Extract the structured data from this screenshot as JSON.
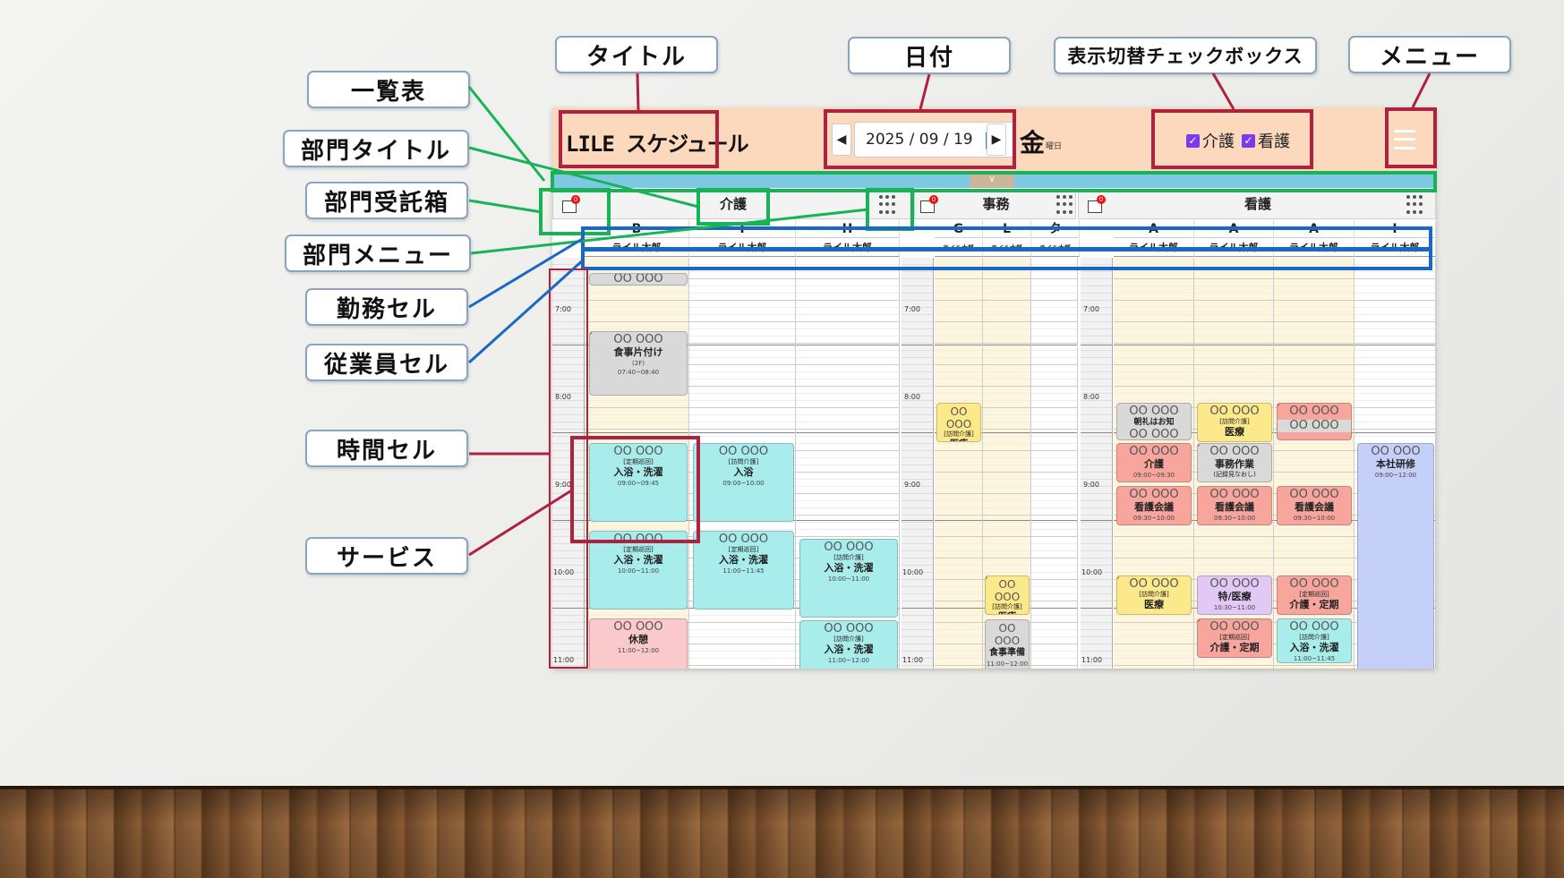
{
  "callouts": {
    "ichiranhyo": "一覧表",
    "bumon_title": "部門タイトル",
    "bumon_inbox": "部門受託箱",
    "bumon_menu": "部門メニュー",
    "kinmu_cell": "勤務セル",
    "jugyoin_cell": "従業員セル",
    "jikan_cell": "時間セル",
    "service": "サービス",
    "title": "タイトル",
    "date": "日付",
    "toggle": "表示切替チェックボックス",
    "menu": "メニュー"
  },
  "header": {
    "title": "LILE スケジュール",
    "date": "2025 / 09 / 19",
    "weekday": "金",
    "weekday_suffix": "曜日",
    "prev_icon": "caret-left-icon",
    "next_icon": "caret-right-icon",
    "toggles": [
      {
        "label": "介護",
        "checked": true
      },
      {
        "label": "看護",
        "checked": true
      }
    ],
    "collapse_glyph": "∨"
  },
  "departments": [
    {
      "title": "介護",
      "inbox_count": "0",
      "shifts": [
        "B",
        "I",
        "H"
      ],
      "employees": [
        "ライル太郎",
        "ライル太郎",
        "ライル太郎"
      ]
    },
    {
      "title": "事務",
      "inbox_count": "0",
      "shifts": [
        "G",
        "L",
        "タ"
      ],
      "employees": [
        "ライル太郎",
        "ライル太郎",
        "ライル太郎"
      ]
    },
    {
      "title": "看護",
      "inbox_count": "0",
      "shifts": [
        "A",
        "A",
        "A",
        "I"
      ],
      "employees": [
        "ライル太郎",
        "ライル太郎",
        "ライル太郎",
        "ライル太郎"
      ]
    }
  ],
  "times": [
    "7:00",
    "8:00",
    "9:00",
    "10:00",
    "11:00"
  ],
  "services": {
    "c0a": {
      "top": "OO OOO"
    },
    "c0b": {
      "top": "OO OOO",
      "tag": "",
      "name": "食事片付け",
      "sub": "(2F)",
      "time": "07:40~08:40"
    },
    "c0c": {
      "top": "OO OOO",
      "tag": "[定期巡回]",
      "name": "入浴・洗濯",
      "time": "09:00~09:45"
    },
    "c0d": {
      "top": "OO OOO",
      "tag": "[定期巡回]",
      "name": "入浴・洗濯",
      "time": "10:00~11:00"
    },
    "c0e": {
      "top": "OO OOO",
      "name": "休憩",
      "time": "11:00~12:00"
    },
    "c1a": {
      "top": "OO OOO",
      "tag": "[訪問介護]",
      "name": "入浴",
      "time": "09:00~10:00"
    },
    "c1b": {
      "top": "OO OOO",
      "tag": "[定期巡回]",
      "name": "入浴・洗濯",
      "time": "11:00~11:45"
    },
    "c2a": {
      "top": "OO OOO",
      "tag": "[訪問介護]",
      "name": "入浴・洗濯",
      "time": "10:00~11:00"
    },
    "c2b": {
      "top": "OO OOO",
      "tag": "[訪問介護]",
      "name": "入浴・洗濯",
      "time": "11:00~12:00"
    },
    "j0a": {
      "top": "OO OOO",
      "tag": "[訪問介護]",
      "name": "医療"
    },
    "j1a": {
      "top": "OO OOO",
      "tag": "[訪問介護]",
      "name": "医療"
    },
    "j1b": {
      "top": "OO OOO",
      "name": "食事準備",
      "time": "11:00~12:00"
    },
    "k0a": {
      "top": "OO OOO",
      "name": "朝礼はお知",
      "bottom": "OO OOO"
    },
    "k0b": {
      "top": "OO OOO",
      "name": "介護",
      "time": "09:00~09:30"
    },
    "k0c": {
      "top": "OO OOO",
      "name": "看護会議",
      "time": "09:30~10:00"
    },
    "k0d": {
      "top": "OO OOO",
      "tag": "[訪問介護]",
      "name": "医療"
    },
    "k1a": {
      "top": "OO OOO",
      "tag": "[訪問介護]",
      "name": "医療"
    },
    "k1b": {
      "top": "OO OOO",
      "name": "事務作業",
      "sub": "(記録見なおし)"
    },
    "k1c": {
      "top": "OO OOO",
      "name": "看護会議",
      "time": "09:30~10:00"
    },
    "k1d": {
      "top": "OO OOO",
      "name": "特/医療",
      "time": "10:30~11:00"
    },
    "k1e": {
      "top": "OO OOO",
      "tag": "[定期巡回]",
      "name": "介護・定期"
    },
    "k2a": {
      "top": "OO OOO",
      "bottom": "OO OOO"
    },
    "k2b": {
      "top": "OO OOO",
      "name": "看護会議",
      "time": "09:30~10:00"
    },
    "k2c": {
      "top": "OO OOO",
      "tag": "[定期巡回]",
      "name": "介護・定期"
    },
    "k2d": {
      "top": "OO OOO",
      "tag": "[訪問介護]",
      "name": "入浴・洗濯",
      "time": "11:00~11:45"
    },
    "k3a": {
      "top": "OO OOO",
      "name": "本社研修",
      "time": "09:00~12:00"
    }
  },
  "colors": {
    "header_bg": "#fcd9bc",
    "collapse_bar": "#7ec8e3",
    "gray": "#d9d9d9",
    "teal": "#a8ecec",
    "pink": "#f9c9cc",
    "yellow": "#fbe98c",
    "red": "#f7a59d",
    "purple": "#e2c8f5",
    "lavender": "#c5d0f9",
    "frame_red": "#b0213f",
    "frame_green": "#17b356",
    "frame_blue": "#1b67c4"
  }
}
